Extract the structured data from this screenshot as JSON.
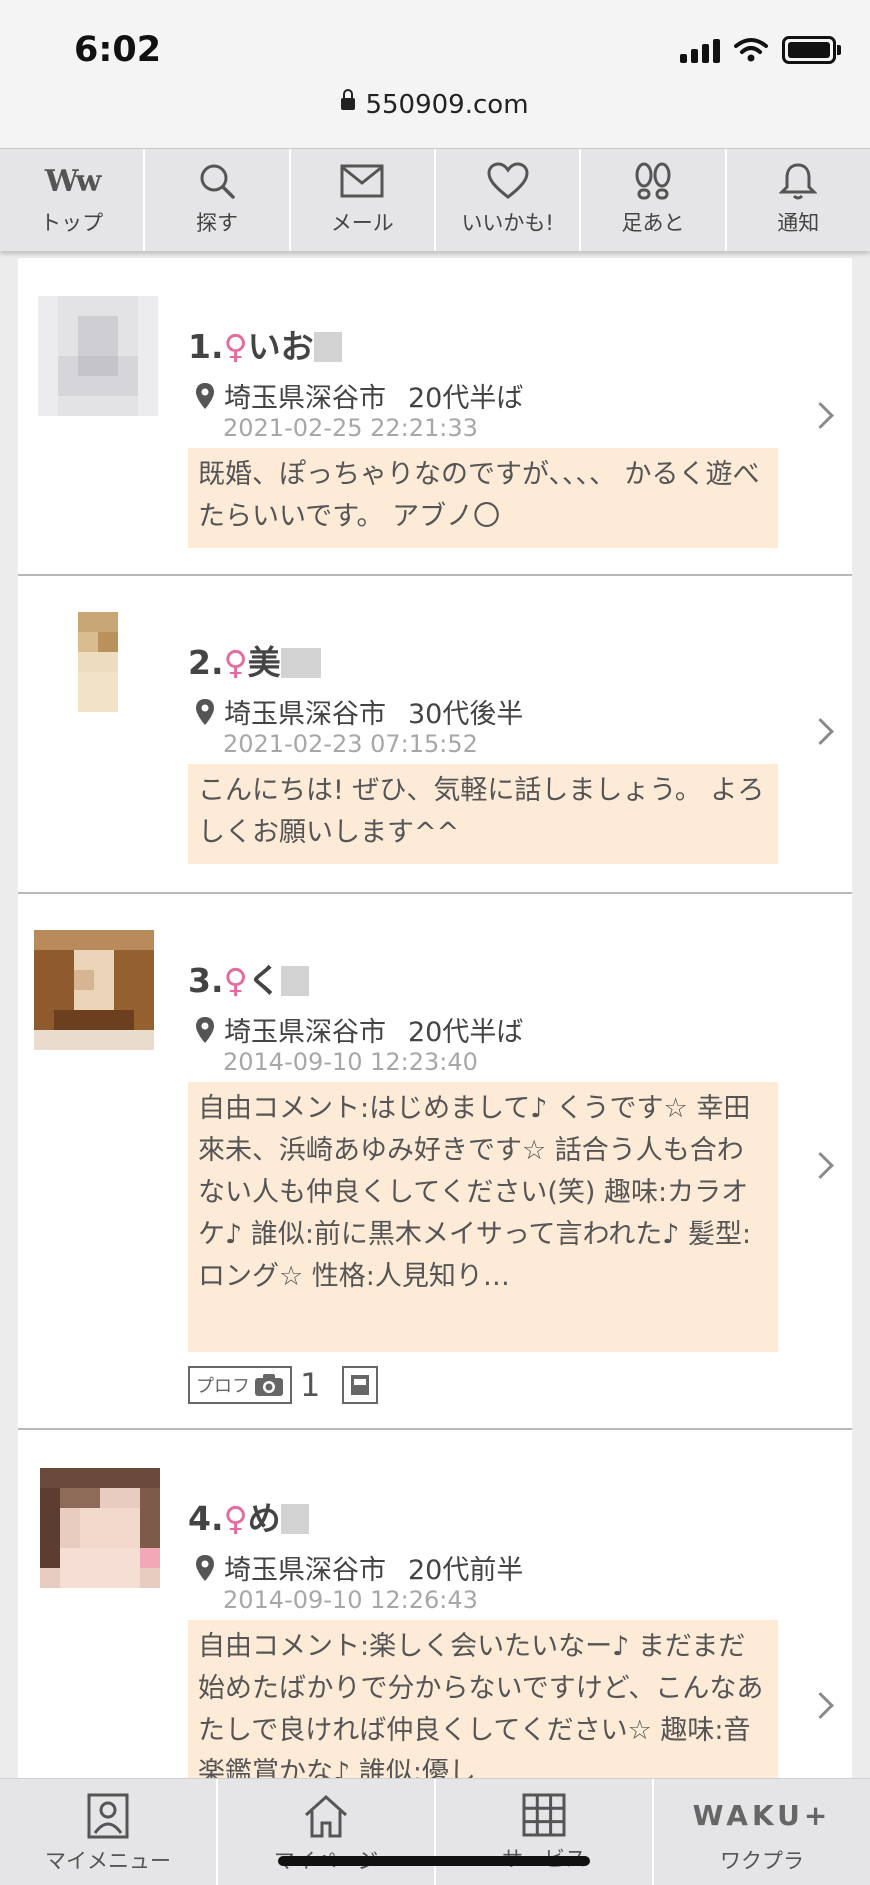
{
  "status": {
    "time": "6:02",
    "url": "550909.com"
  },
  "topnav": [
    {
      "label": "トップ",
      "icon": "ww-logo-icon"
    },
    {
      "label": "探す",
      "icon": "search-icon"
    },
    {
      "label": "メール",
      "icon": "mail-icon"
    },
    {
      "label": "いいかも!",
      "icon": "heart-icon"
    },
    {
      "label": "足あと",
      "icon": "footprint-icon"
    },
    {
      "label": "通知",
      "icon": "bell-icon"
    }
  ],
  "nav_logo_text": "Ww",
  "profiles": [
    {
      "rank": "1.",
      "gender_symbol": "♀",
      "name": "いお",
      "location": "埼玉県深谷市",
      "age": "20代半ば",
      "date": "2021-02-25 22:21:33",
      "comment": "既婚、ぽっちゃりなのですが、、、、 かるく遊べたらいいです。 アブノ〇"
    },
    {
      "rank": "2.",
      "gender_symbol": "♀",
      "name": "美",
      "location": "埼玉県深谷市",
      "age": "30代後半",
      "date": "2021-02-23 07:15:52",
      "comment": "こんにちは! ぜひ、気軽に話しましょう。 よろしくお願いします^^"
    },
    {
      "rank": "3.",
      "gender_symbol": "♀",
      "name": "く",
      "location": "埼玉県深谷市",
      "age": "20代半ば",
      "date": "2014-09-10 12:23:40",
      "comment": "自由コメント:はじめまして♪ くうです☆ 幸田來未、浜崎あゆみ好きです☆ 話合う人も合わない人も仲良くしてください(笑) 趣味:カラオケ♪ 誰似:前に黒木メイサって言われた♪ 髪型:ロング☆ 性格:人見知り…",
      "badge_label": "プロフ",
      "badge_count": "1"
    },
    {
      "rank": "4.",
      "gender_symbol": "♀",
      "name": "め",
      "location": "埼玉県深谷市",
      "age": "20代前半",
      "date": "2014-09-10 12:26:43",
      "comment": "自由コメント:楽しく会いたいなー♪ まだまだ始めたばかりで分からないですけど、こんなあたしで良ければ仲良くしてください☆ 趣味:音楽鑑賞かな♪ 誰似:優し"
    }
  ],
  "bottomnav": [
    {
      "label": "マイメニュー",
      "icon": "person-card-icon"
    },
    {
      "label": "マイページ",
      "icon": "home-icon"
    },
    {
      "label": "サービス",
      "icon": "grid-icon"
    },
    {
      "label": "ワクプラ",
      "logo": "WAKU+"
    }
  ]
}
